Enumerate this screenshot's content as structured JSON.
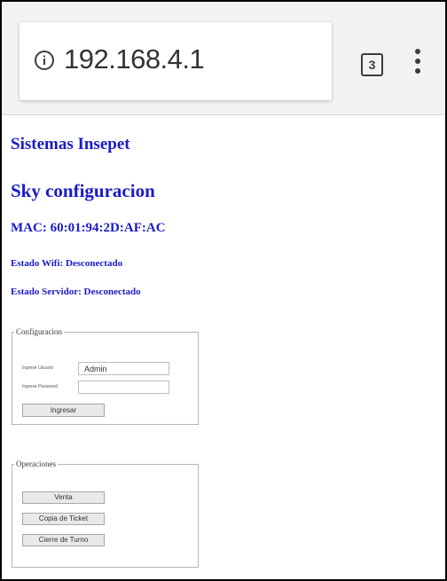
{
  "browser": {
    "url": "192.168.4.1",
    "tab_count": "3",
    "info_icon": "info-icon",
    "menu_icon": "more-vert-icon"
  },
  "page": {
    "title": "Sistemas Insepet",
    "subtitle": "Sky configuracion",
    "mac": "MAC: 60:01:94:2D:AF:AC",
    "wifi_status": "Estado Wifi: Desconectado",
    "server_status": "Estado Servidor: Desconectado"
  },
  "config": {
    "legend": "Configuracion",
    "user_label": "Ingrese Usuario",
    "user_value": "Admin",
    "password_label": "Ingrese Password",
    "password_value": "",
    "login_button": "Ingresar"
  },
  "operations": {
    "legend": "Operaciones",
    "buttons": [
      "Venta",
      "Copia de Ticket",
      "Cierre de Turno"
    ]
  },
  "colors": {
    "heading": "#1a1ac8",
    "chrome_bg": "#f2f2f2"
  }
}
